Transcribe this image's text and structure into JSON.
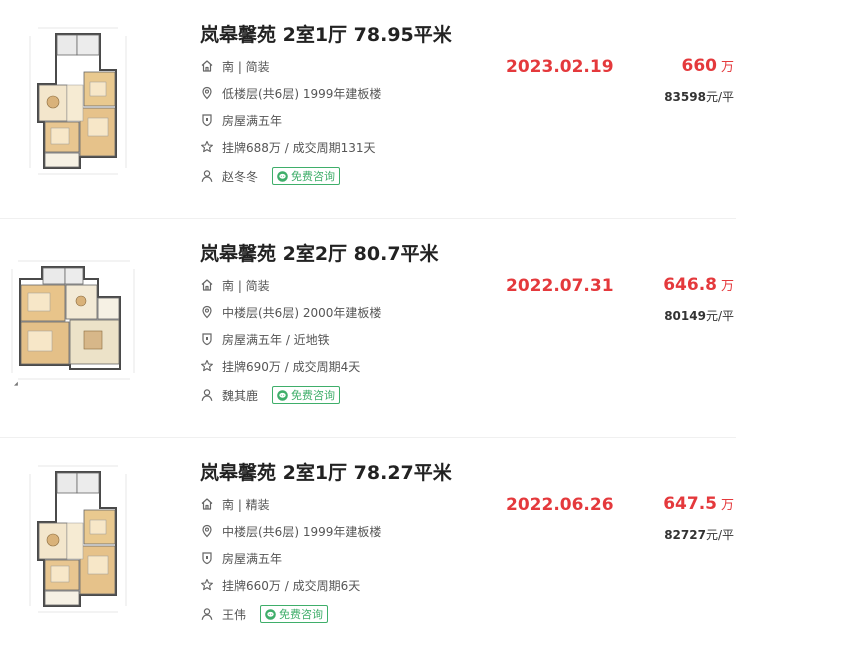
{
  "listings": [
    {
      "title": "岚皋馨苑 2室1厅 78.95平米",
      "orientation_decoration": "南 | 简装",
      "floor_info": "低楼层(共6层) 1999年建板楼",
      "features": "房屋满五年",
      "deal_cycle": "挂牌688万 / 成交周期131天",
      "agent": "赵冬冬",
      "consult_label": "免费咨询",
      "deal_date": "2023.02.19",
      "total_price": "660",
      "total_unit": "万",
      "unit_price_value": "83598",
      "unit_price_suffix": "元/平",
      "plan_variant": "a"
    },
    {
      "title": "岚皋馨苑 2室2厅 80.7平米",
      "orientation_decoration": "南 | 简装",
      "floor_info": "中楼层(共6层) 2000年建板楼",
      "features": "房屋满五年 / 近地铁",
      "deal_cycle": "挂牌690万 / 成交周期4天",
      "agent": "魏其鹿",
      "consult_label": "免费咨询",
      "deal_date": "2022.07.31",
      "total_price": "646.8",
      "total_unit": "万",
      "unit_price_value": "80149",
      "unit_price_suffix": "元/平",
      "plan_variant": "b"
    },
    {
      "title": "岚皋馨苑 2室1厅 78.27平米",
      "orientation_decoration": "南 | 精装",
      "floor_info": "中楼层(共6层) 1999年建板楼",
      "features": "房屋满五年",
      "deal_cycle": "挂牌660万 / 成交周期6天",
      "agent": "王伟",
      "consult_label": "免费咨询",
      "deal_date": "2022.06.26",
      "total_price": "647.5",
      "total_unit": "万",
      "unit_price_value": "82727",
      "unit_price_suffix": "元/平",
      "plan_variant": "a"
    }
  ],
  "icons": {
    "house": "house-icon",
    "location": "location-pin-icon",
    "shield": "shield-icon",
    "star": "star-icon",
    "person": "person-icon",
    "chat": "wechat-chat-icon"
  },
  "colors": {
    "price_red": "#e4393c",
    "consult_green": "#3fae6a",
    "title": "#222222",
    "text": "#555555",
    "icon": "#666666"
  }
}
